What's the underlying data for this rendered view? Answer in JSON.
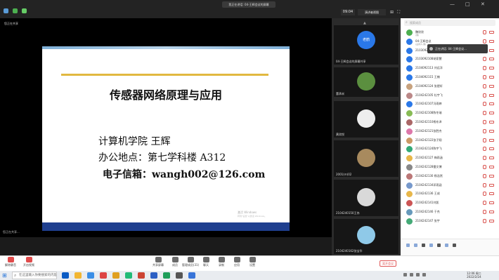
{
  "meeting": {
    "title": "我正在讲话: 04-王辉会议的屏幕",
    "timer": "09:04",
    "gallery_view": "演讲者视图",
    "share_status": "您正在共享",
    "share_bottom": "您正在共享..."
  },
  "slide": {
    "title": "传感器网络原理与应用",
    "line1": "计算机学院    王辉",
    "line2": "办公地点：第七学科楼 A312",
    "line3": "电子信箱：wangh002@126.com",
    "watermark1": "激活 Windows",
    "watermark2": "转到\"设置\"以激活 Windows。"
  },
  "video_tiles": [
    {
      "label": "",
      "avatar_text": "老鹤"
    },
    {
      "label": "04-王辉会议的屏幕共享"
    },
    {
      "label": "董承米"
    },
    {
      "label": "黄欣悦"
    },
    {
      "label": "2001(m)02"
    },
    {
      "label": "2104240150王伟"
    },
    {
      "label": "2104240162张宝华"
    }
  ],
  "tooltip": "正在讲话: 04-王辉会议...",
  "participants_search": "搜索成员",
  "participants": [
    {
      "name": "魏欣欣",
      "sub": "(我)",
      "color": "#4caf50"
    },
    {
      "name": "04-王辉会议",
      "sub": "(主持人,我)",
      "color": "#2a78e8"
    },
    {
      "name": "2103092105王子莉",
      "sub": "",
      "color": "#2a78e8"
    },
    {
      "name": "2103092108胡家慧",
      "sub": "",
      "color": "#2a78e8"
    },
    {
      "name": "2104092113 刘远洋",
      "sub": "",
      "color": "#2a78e8"
    },
    {
      "name": "2104092115 王楠",
      "sub": "",
      "color": "#2a78e8"
    },
    {
      "name": "2104092124 张煜轩",
      "sub": "",
      "color": "#c7a27e"
    },
    {
      "name": "2104242105 杜宇飞",
      "sub": "",
      "color": "#b88"
    },
    {
      "name": "2104242107冯雨婷",
      "sub": "",
      "color": "#2a78e8"
    },
    {
      "name": "2104242108陈冬瑞",
      "sub": "",
      "color": "#8b5"
    },
    {
      "name": "2104242110杨东泽",
      "sub": "",
      "color": "#a66"
    },
    {
      "name": "2104242121张胜杰",
      "sub": "",
      "color": "#d7a"
    },
    {
      "name": "2104242122张子翔",
      "sub": "",
      "color": "#c96"
    },
    {
      "name": "2104242124陈宇飞",
      "sub": "",
      "color": "#3a7"
    },
    {
      "name": "2104242127 梅雨涵",
      "sub": "",
      "color": "#e8b74a"
    },
    {
      "name": "2104242128雷文博",
      "sub": "",
      "color": "#888"
    },
    {
      "name": "2104242130 杨浩然",
      "sub": "",
      "color": "#b77"
    },
    {
      "name": "2104242134邓雨涵",
      "sub": "",
      "color": "#79c"
    },
    {
      "name": "2104242136 王成",
      "sub": "",
      "color": "#e8b74a"
    },
    {
      "name": "2104242141刘凯",
      "sub": "",
      "color": "#c55"
    },
    {
      "name": "2104242146 于杰",
      "sub": "",
      "color": "#69b"
    },
    {
      "name": "2104242147 张宇",
      "sub": "",
      "color": "#4a7"
    }
  ],
  "toolbar": {
    "mute": "解除静音",
    "video": "开启视频",
    "share": "共享屏幕",
    "members": "成员",
    "manage": "管理成员(31)",
    "chat": "聊天",
    "record": "录制",
    "apps": "应用",
    "settings": "设置",
    "leave": "离开会议"
  },
  "taskbar": {
    "search": "在这里输入你要搜索的内容",
    "time": "12:06 周二",
    "date": "2022/2/24"
  }
}
